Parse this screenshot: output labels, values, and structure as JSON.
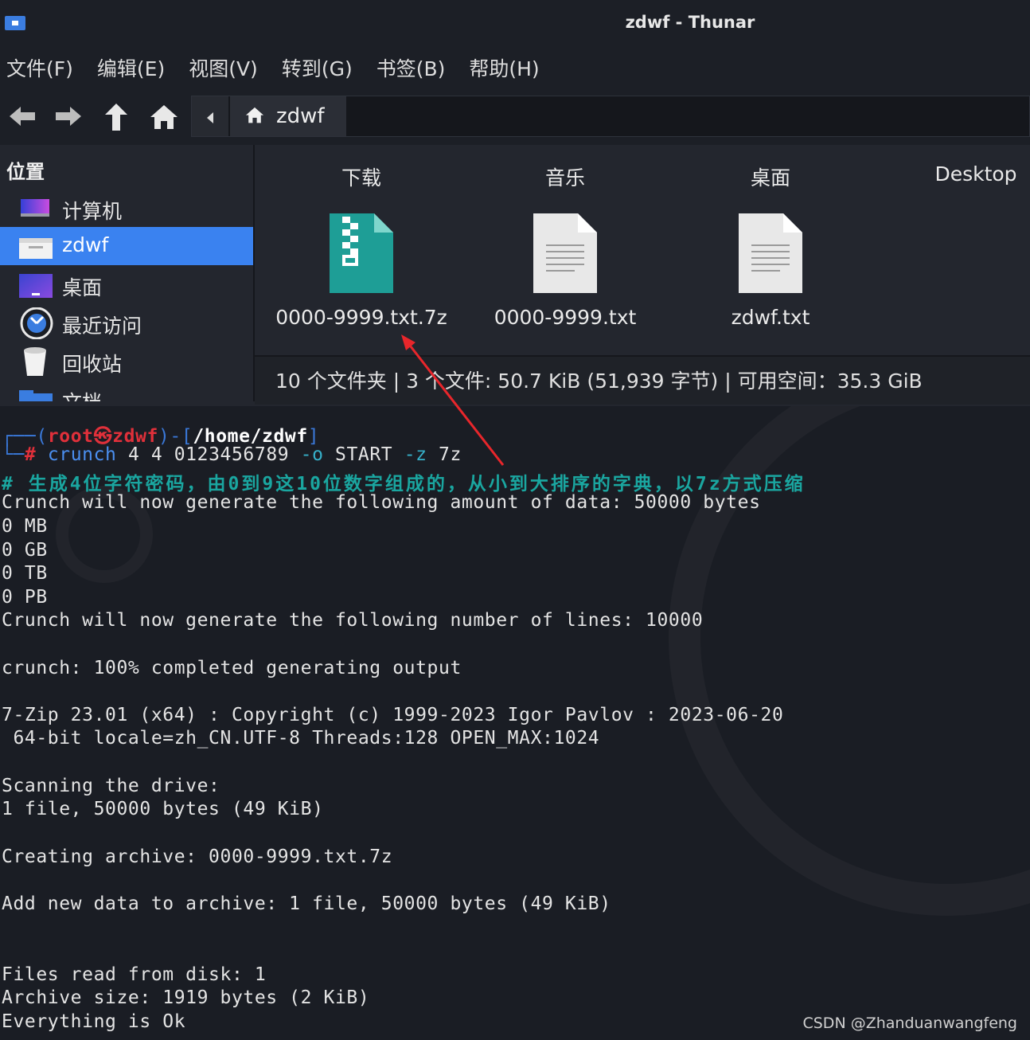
{
  "window": {
    "title": "zdwf - Thunar"
  },
  "menu": [
    "文件(F)",
    "编辑(E)",
    "视图(V)",
    "转到(G)",
    "书签(B)",
    "帮助(H)"
  ],
  "location": {
    "crumb": "zdwf"
  },
  "sidebar": {
    "heading": "位置",
    "items": [
      {
        "label": "计算机",
        "icon": "computer-icon"
      },
      {
        "label": "zdwf",
        "icon": "home-folder-icon",
        "active": true
      },
      {
        "label": "桌面",
        "icon": "desktop-icon"
      },
      {
        "label": "最近访问",
        "icon": "clock-icon"
      },
      {
        "label": "回收站",
        "icon": "trash-icon"
      },
      {
        "label": "文档",
        "icon": "folder-icon"
      }
    ]
  },
  "icon_view": {
    "columns": [
      "下载",
      "音乐",
      "桌面",
      "Desktop"
    ],
    "files": [
      {
        "name": "0000-9999.txt.7z",
        "icon": "archive-icon"
      },
      {
        "name": "0000-9999.txt",
        "icon": "text-file-icon"
      },
      {
        "name": "zdwf.txt",
        "icon": "text-file-icon"
      }
    ]
  },
  "statusbar": {
    "text": "10 个文件夹 | 3 个文件: 50.7 KiB (51,939 字节) | 可用空间：35.3 GiB"
  },
  "terminal": {
    "prompt": {
      "open": "┌──(",
      "user": "root㉿zdwf",
      "mid": ")-[",
      "path": "/home/zdwf",
      "close": "]",
      "hash_line": "└─",
      "hash": "#"
    },
    "command": {
      "cmd": "crunch",
      "args1": " 4 4 0123456789 ",
      "flag1": "-o",
      "args2": " START ",
      "flag2": "-z",
      "args3": " 7z"
    },
    "comment": "# 生成4位字符密码，由0到9这10位数字组成的，从小到大排序的字典，以7z方式压缩",
    "lines": [
      "Crunch will now generate the following amount of data: 50000 bytes",
      "0 MB",
      "0 GB",
      "0 TB",
      "0 PB",
      "Crunch will now generate the following number of lines: 10000",
      "",
      "crunch: 100% completed generating output",
      "",
      "7-Zip 23.01 (x64) : Copyright (c) 1999-2023 Igor Pavlov : 2023-06-20",
      " 64-bit locale=zh_CN.UTF-8 Threads:128 OPEN_MAX:1024",
      "",
      "Scanning the drive:",
      "1 file, 50000 bytes (49 KiB)",
      "",
      "Creating archive: 0000-9999.txt.7z",
      "",
      "Add new data to archive: 1 file, 50000 bytes (49 KiB)",
      "",
      "",
      "Files read from disk: 1",
      "Archive size: 1919 bytes (2 KiB)",
      "Everything is Ok"
    ]
  },
  "watermark": "CSDN @Zhanduanwangfeng",
  "colors": {
    "accent": "#3a82f0",
    "arrow": "#e8262b",
    "archive": "#1e9e96"
  }
}
